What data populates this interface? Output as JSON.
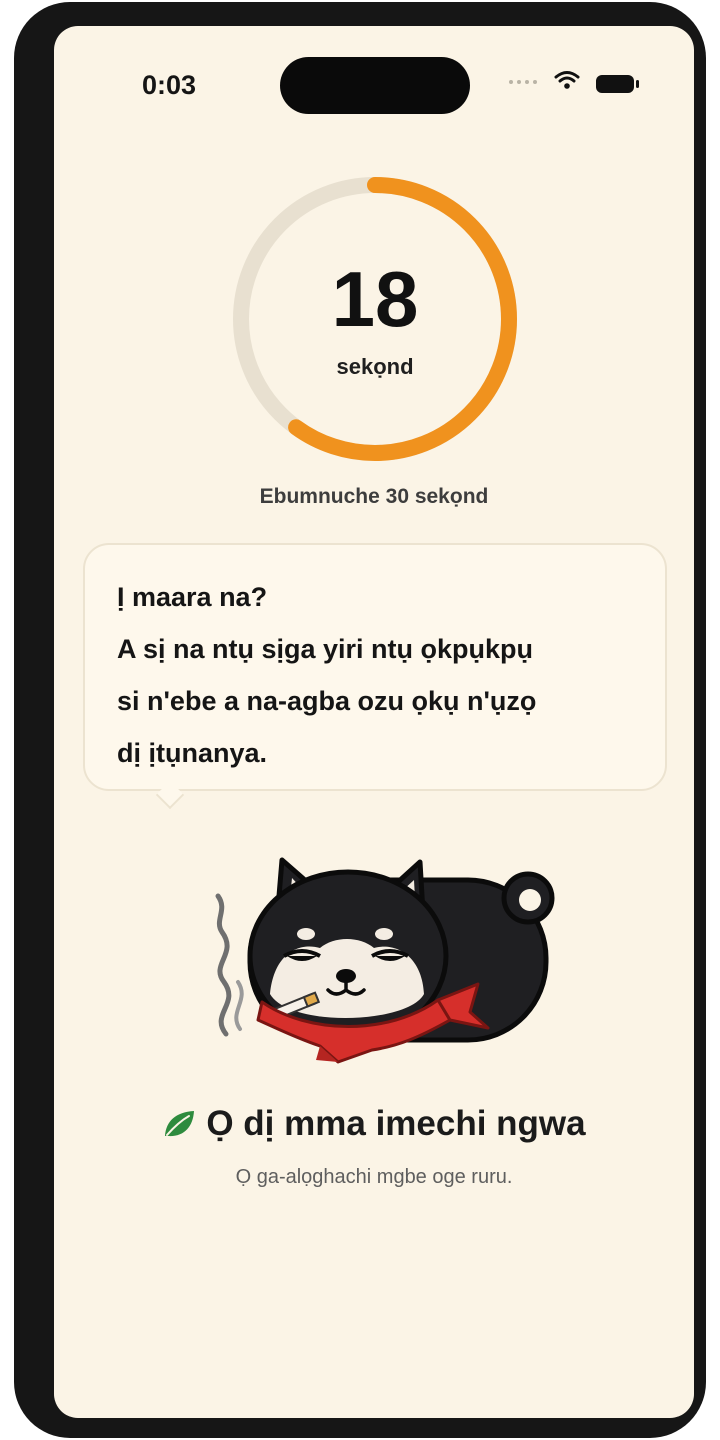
{
  "status_bar": {
    "time": "0:03",
    "wifi_icon": "wifi-icon",
    "battery_icon": "battery-icon"
  },
  "timer": {
    "remaining": "18",
    "unit": "sekọnd",
    "total_label": "Ebumnuche 30 sekọnd",
    "progress_fraction": 0.6,
    "ring_color": "#F0921E",
    "track_color": "#E8E0D0"
  },
  "tip": {
    "lines": [
      "Ị maara na?",
      "A sị na ntụ sịga yiri ntụ ọkpụkpụ",
      "si n'ebe a na-agba ozu ọkụ n'ụzọ",
      "dị ịtụnanya."
    ]
  },
  "mascot": {
    "icon": "smoking-dog-mascot"
  },
  "status": {
    "leaf_icon": "leaf-icon",
    "leaf_color": "#2E8B3E",
    "headline": "Ọ dị mma imechi ngwa",
    "subtitle": "Ọ ga-alọghachi mgbe oge ruru."
  }
}
